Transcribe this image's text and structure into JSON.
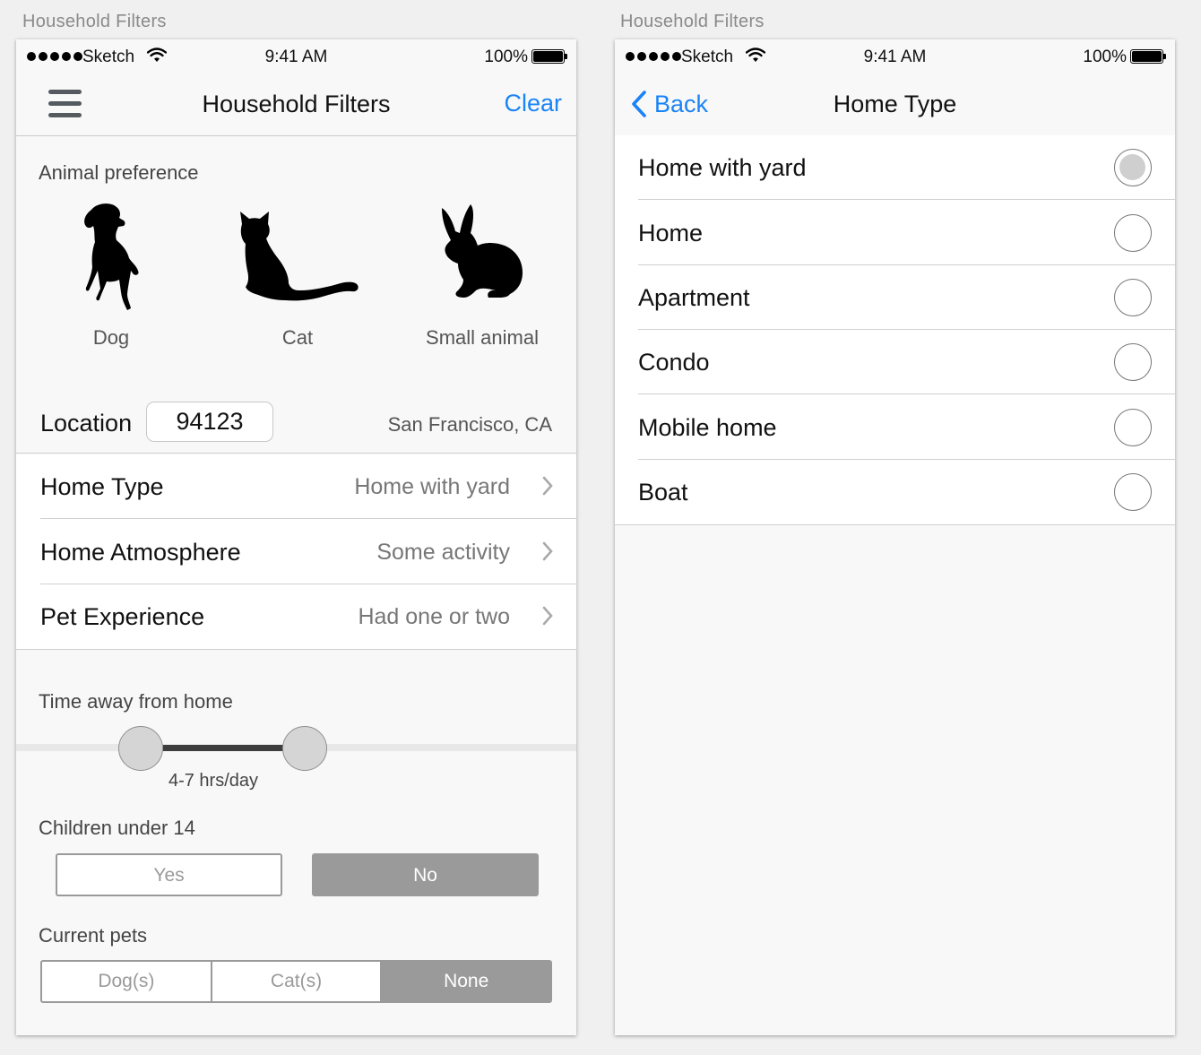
{
  "artboards": {
    "left_title": "Household Filters",
    "right_title": "Household Filters"
  },
  "status_bar": {
    "carrier": "Sketch",
    "time": "9:41 AM",
    "battery": "100%"
  },
  "filters_screen": {
    "title": "Household Filters",
    "clear_label": "Clear",
    "animal_section_label": "Animal preference",
    "animals": [
      {
        "label": "Dog",
        "icon": "dog-icon"
      },
      {
        "label": "Cat",
        "icon": "cat-icon"
      },
      {
        "label": "Small animal",
        "icon": "rabbit-icon"
      }
    ],
    "location": {
      "label": "Location",
      "zip": "94123",
      "city": "San Francisco, CA"
    },
    "rows": [
      {
        "label": "Home Type",
        "value": "Home with yard"
      },
      {
        "label": "Home Atmosphere",
        "value": "Some activity"
      },
      {
        "label": "Pet Experience",
        "value": "Had one or two"
      }
    ],
    "time_away": {
      "label": "Time away from home",
      "value": "4-7 hrs/day"
    },
    "children": {
      "label": "Children under 14",
      "yes": "Yes",
      "no": "No",
      "selected": "No"
    },
    "current_pets": {
      "label": "Current pets",
      "options": [
        "Dog(s)",
        "Cat(s)",
        "None"
      ],
      "selected": "None"
    }
  },
  "home_type_screen": {
    "back_label": "Back",
    "title": "Home Type",
    "options": [
      {
        "label": "Home with yard",
        "selected": true
      },
      {
        "label": "Home",
        "selected": false
      },
      {
        "label": "Apartment",
        "selected": false
      },
      {
        "label": "Condo",
        "selected": false
      },
      {
        "label": "Mobile home",
        "selected": false
      },
      {
        "label": "Boat",
        "selected": false
      }
    ]
  },
  "colors": {
    "accent_blue": "#1a83f6",
    "toggle_gray": "#9a9a9a"
  }
}
